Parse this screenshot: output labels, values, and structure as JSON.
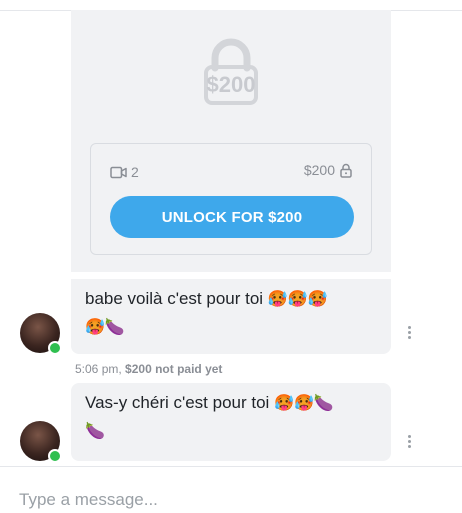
{
  "ppv_message": {
    "preview_price": "$200",
    "media_count": "2",
    "price": "$200",
    "unlock_label": "UNLOCK FOR $200"
  },
  "messages": [
    {
      "text": "babe voilà c'est pour toi",
      "emojis": "🥵🥵🥵",
      "emojis_line2": "🥵🍆"
    },
    {
      "text": "Vas-y chéri c'est pour toi",
      "emojis": "🥵🥵🍆",
      "emojis_line2": "🍆"
    }
  ],
  "meta": {
    "time": "5:06 pm,",
    "status": "$200 not paid yet"
  },
  "composer": {
    "placeholder": "Type a message..."
  },
  "colors": {
    "accent": "#3ea8eb",
    "bubble": "#f1f2f4",
    "online": "#2fbf50"
  }
}
